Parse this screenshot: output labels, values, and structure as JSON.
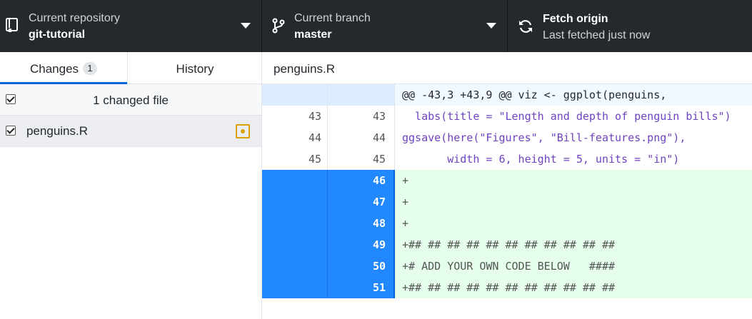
{
  "toolbar": {
    "repository": {
      "label": "Current repository",
      "value": "git-tutorial"
    },
    "branch": {
      "label": "Current branch",
      "value": "master"
    },
    "fetch": {
      "label": "Fetch origin",
      "status": "Last fetched just now"
    }
  },
  "sidebar": {
    "tabs": [
      {
        "label": "Changes",
        "badge": "1",
        "active": true
      },
      {
        "label": "History",
        "active": false
      }
    ],
    "changed_files_label": "1 changed file",
    "files": [
      {
        "name": "penguins.R",
        "status": "modified",
        "checked": true
      }
    ]
  },
  "diff": {
    "filename": "penguins.R",
    "hunk_header": "@@ -43,3 +43,9 @@ viz <- ggplot(penguins,",
    "lines": [
      {
        "type": "context",
        "old": "43",
        "new": "43",
        "code": "  labs(title = \"Length and depth of penguin bills\")"
      },
      {
        "type": "context",
        "old": "44",
        "new": "44",
        "code": "ggsave(here(\"Figures\", \"Bill-features.png\"),",
        "indent": ""
      },
      {
        "type": "context",
        "old": "45",
        "new": "45",
        "code": "       width = 6, height = 5, units = \"in\")"
      },
      {
        "type": "add",
        "old": "",
        "new": "46",
        "code": "+"
      },
      {
        "type": "add",
        "old": "",
        "new": "47",
        "code": "+"
      },
      {
        "type": "add",
        "old": "",
        "new": "48",
        "code": "+"
      },
      {
        "type": "add",
        "old": "",
        "new": "49",
        "code": "+## ## ## ## ## ## ## ## ## ## ##"
      },
      {
        "type": "add",
        "old": "",
        "new": "50",
        "code": "+# ADD YOUR OWN CODE BELOW   ####"
      },
      {
        "type": "add",
        "old": "",
        "new": "51",
        "code": "+## ## ## ## ## ## ## ## ## ## ##"
      }
    ]
  }
}
